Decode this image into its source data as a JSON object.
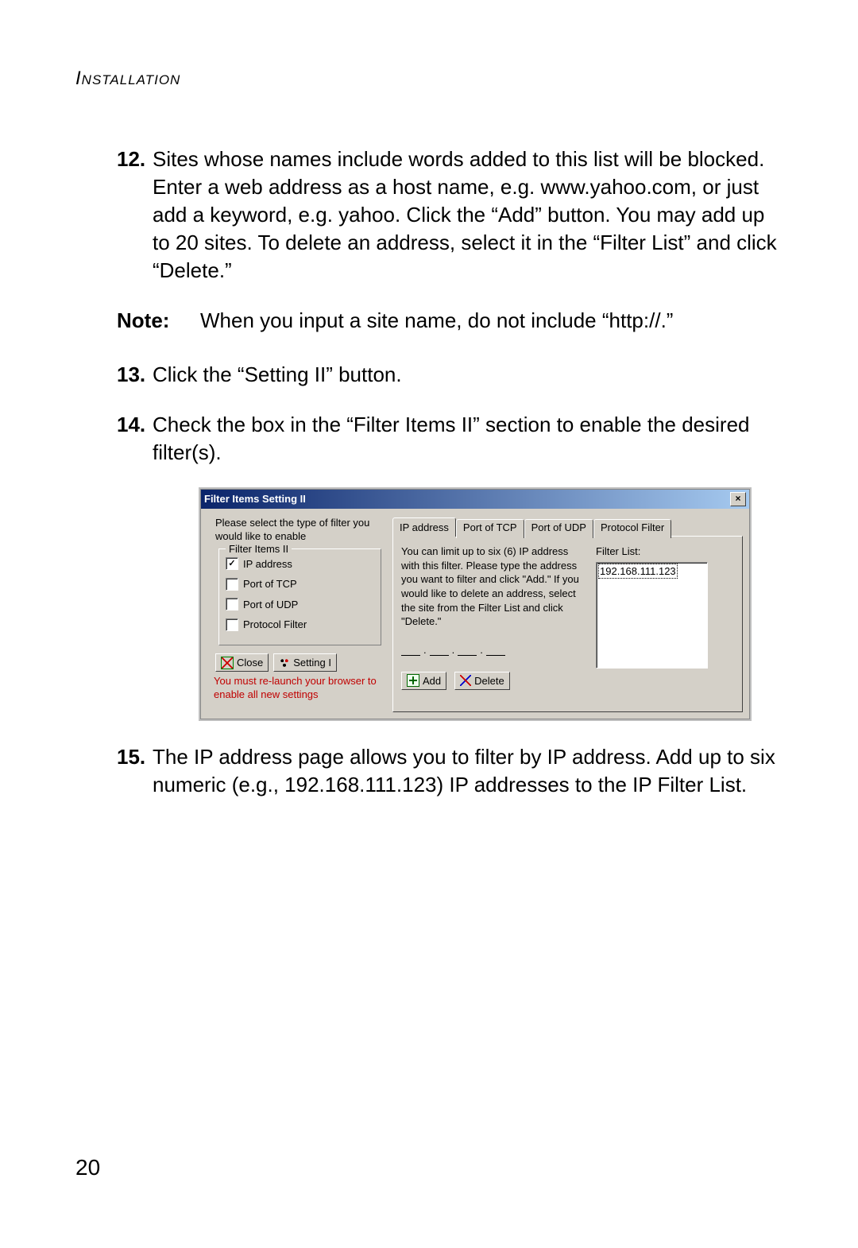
{
  "section_header": "Installation",
  "page_number": "20",
  "steps": {
    "s12": {
      "num": "12.",
      "text": "Sites whose names include words added to this list will be blocked. Enter a web address as a host name, e.g. www.yahoo.com, or just add a keyword, e.g. yahoo. Click the “Add” button. You may add up to 20 sites. To delete an address, select it in the “Filter List” and click “Delete.”"
    },
    "note": {
      "label": "Note:",
      "text": "When you input a site name, do not include “http://.”"
    },
    "s13": {
      "num": "13.",
      "text": "Click the “Setting II” button."
    },
    "s14": {
      "num": "14.",
      "text": "Check the box in the “Filter Items II” section to enable the desired filter(s)."
    },
    "s15": {
      "num": "15.",
      "text": "The IP address page allows you to filter by IP address. Add up to six numeric (e.g., 192.168.111.123) IP addresses to the IP Filter List."
    }
  },
  "dialog": {
    "title": "Filter Items Setting II",
    "close_x": "×",
    "intro": "Please select the type of filter you would like to enable",
    "group_legend": "Filter Items II",
    "checks": {
      "ip": {
        "label": "IP address",
        "checked": true
      },
      "tcp": {
        "label": "Port of TCP",
        "checked": false
      },
      "udp": {
        "label": "Port of UDP",
        "checked": false
      },
      "prot": {
        "label": "Protocol Filter",
        "checked": false
      }
    },
    "close_btn": "Close",
    "setting_btn": "Setting I",
    "relaunch": "You must re-launch your browser to enable all new settings",
    "tabs": {
      "ip": "IP address",
      "tcp": "Port of TCP",
      "udp": "Port of UDP",
      "prot": "Protocol Filter"
    },
    "tab_desc": "You can limit up to six (6) IP address with this filter. Please type the address you want to filter and click \"Add.\"  If you would like to delete an address, select the site from the Filter List and click \"Delete.\"",
    "add_btn": "Add",
    "delete_btn": "Delete",
    "filter_list_label": "Filter List:",
    "filter_list_item": "192.168.111.123"
  }
}
